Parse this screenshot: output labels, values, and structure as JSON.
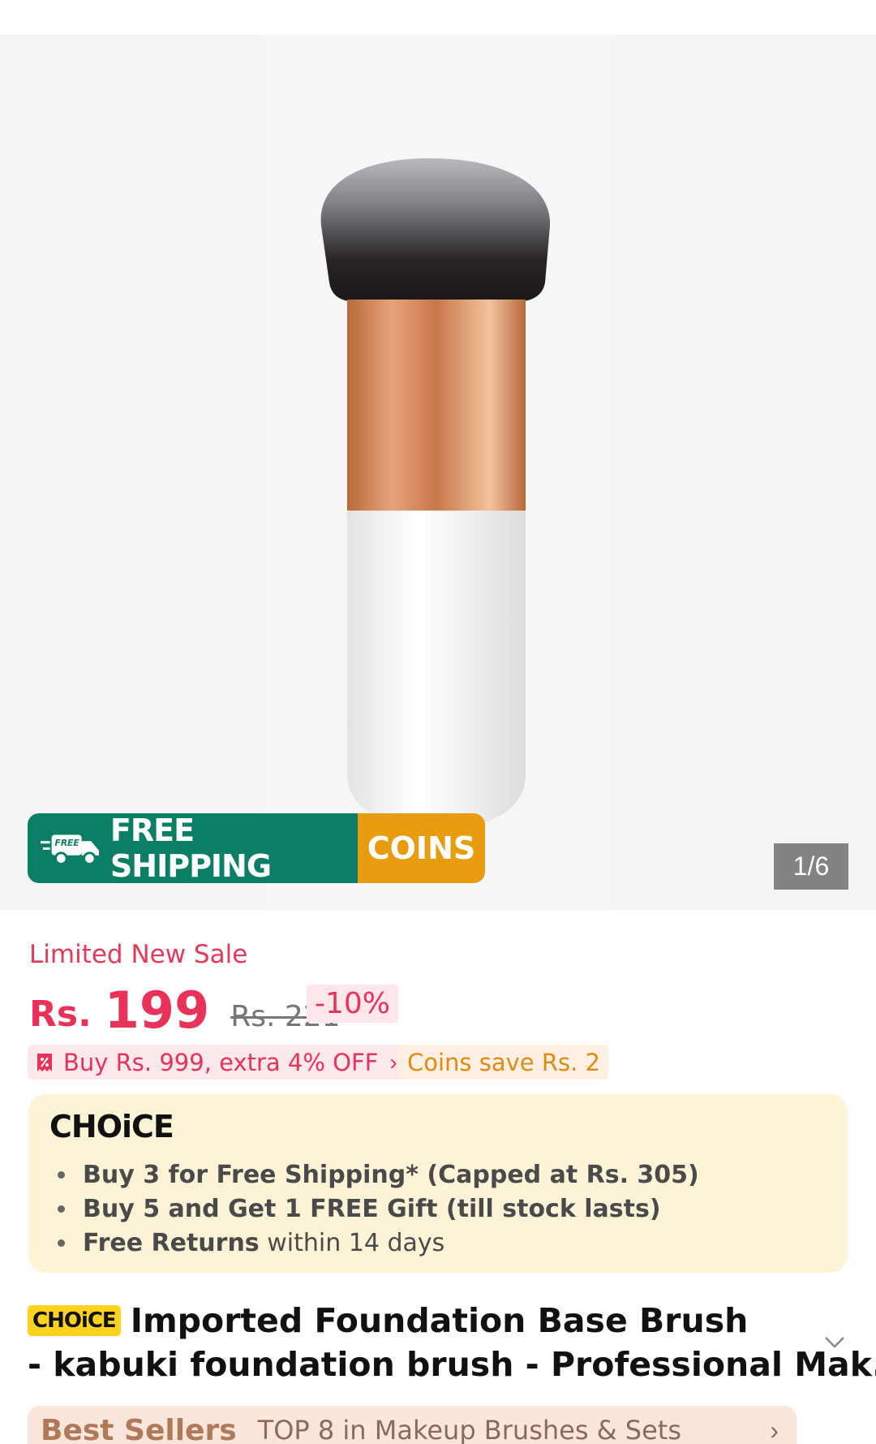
{
  "gallery": {
    "counter": "1/6",
    "shipping_banner": {
      "left_text": "FREE SHIPPING",
      "right_text": "COINS",
      "truck_badge": "FREE"
    }
  },
  "price": {
    "sale_label": "Limited New Sale",
    "currency": "Rs.",
    "current": "199",
    "original": "Rs. 221",
    "discount": "-10%"
  },
  "promos": {
    "bundle_offer": "Buy Rs. 999, extra 4% OFF",
    "coins_save": "Coins save Rs. 2"
  },
  "choice": {
    "logo": "CHOiCE",
    "items": [
      {
        "bold": "Buy 3 for  Free Shipping* (Capped at Rs. 305)",
        "rest": ""
      },
      {
        "bold": "Buy 5 and Get 1 FREE Gift (till stock lasts)",
        "rest": ""
      },
      {
        "bold": "Free Returns",
        "rest": " within 14 days"
      }
    ]
  },
  "product": {
    "badge": "CHOiCE",
    "title_line1": "Imported Foundation Base Brush",
    "title_line2": "- kabuki foundation brush - Professional Mak..."
  },
  "best_sellers": {
    "title": "Best Sellers",
    "subtitle": "TOP 8 in Makeup Brushes & Sets"
  },
  "colors": {
    "price_red": "#e8325a",
    "shipping_green": "#0b7f66",
    "coins_orange": "#e89d10",
    "choice_yellow": "#ffd21f",
    "choice_card_bg": "#fdf3d6"
  },
  "icons": [
    "truck-icon",
    "coupon-icon",
    "chevron-right-icon",
    "chevron-down-icon"
  ]
}
